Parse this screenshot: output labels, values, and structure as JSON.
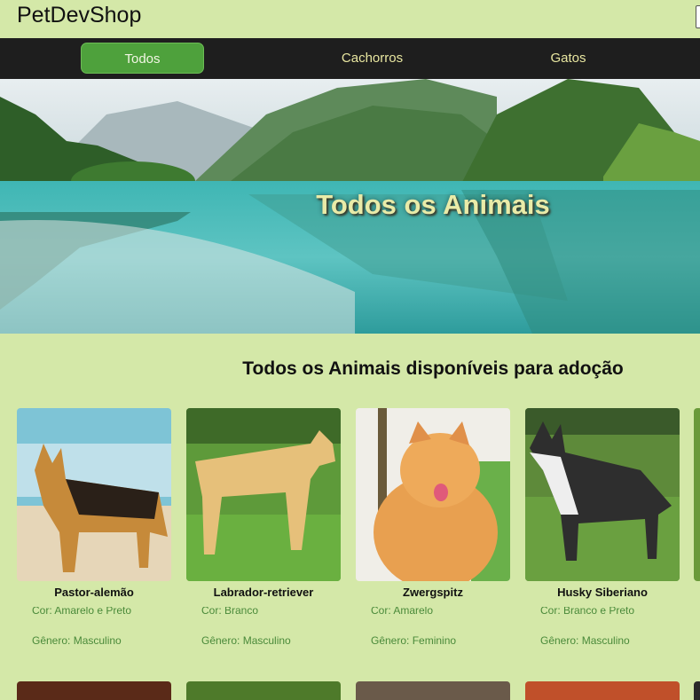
{
  "app": {
    "logo": "PetDevShop"
  },
  "nav": {
    "items": [
      {
        "label": "Todos",
        "active": true
      },
      {
        "label": "Cachorros",
        "active": false
      },
      {
        "label": "Gatos",
        "active": false
      }
    ]
  },
  "hero": {
    "title": "Todos os Animais"
  },
  "section": {
    "title": "Todos os Animais disponíveis para adoção"
  },
  "animals": [
    {
      "name": "Pastor-alemão",
      "color": "Cor: Amarelo e Preto",
      "gender": "Gênero: Masculino"
    },
    {
      "name": "Labrador-retriever",
      "color": "Cor: Branco",
      "gender": "Gênero: Masculino"
    },
    {
      "name": "Zwergspitz",
      "color": "Cor: Amarelo",
      "gender": "Gênero: Feminino"
    },
    {
      "name": "Husky Siberiano",
      "color": "Cor: Branco e Preto",
      "gender": "Gênero: Masculino"
    }
  ],
  "colors": {
    "page_bg": "#d4e8a8",
    "nav_bg": "#1e1e1e",
    "nav_active": "#4ea13c",
    "nav_text": "#e8e6a0",
    "detail_text": "#4a8a3a"
  }
}
